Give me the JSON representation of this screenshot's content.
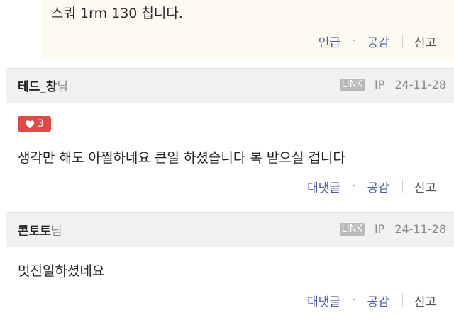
{
  "prev_reply": {
    "text": "스쿼 1rm 130 칩니다.",
    "actions": {
      "mention": "언급",
      "separator": "·",
      "like": "공감",
      "report": "신고"
    }
  },
  "comments": [
    {
      "nickname": "테드_창",
      "suffix": "님",
      "link_badge": "LINK",
      "ip_label": "IP",
      "date": "24-11-28",
      "likes": "3",
      "text": "생각만 해도 아찔하네요 큰일 하셨습니다 복 받으실 겁니다",
      "actions": {
        "reply": "대댓글",
        "separator": "·",
        "like": "공감",
        "report": "신고"
      }
    },
    {
      "nickname": "콘토토",
      "suffix": "님",
      "link_badge": "LINK",
      "ip_label": "IP",
      "date": "24-11-28",
      "text": "멋진일하셨네요",
      "actions": {
        "reply": "대댓글",
        "separator": "·",
        "like": "공감",
        "report": "신고"
      }
    }
  ],
  "colors": {
    "like_badge": "#e04a46",
    "action_link": "#4a5aa6",
    "reply_bg": "#fdfbf1",
    "header_bg": "#f1f1f1"
  },
  "icons": {
    "like": "heart-icon"
  }
}
